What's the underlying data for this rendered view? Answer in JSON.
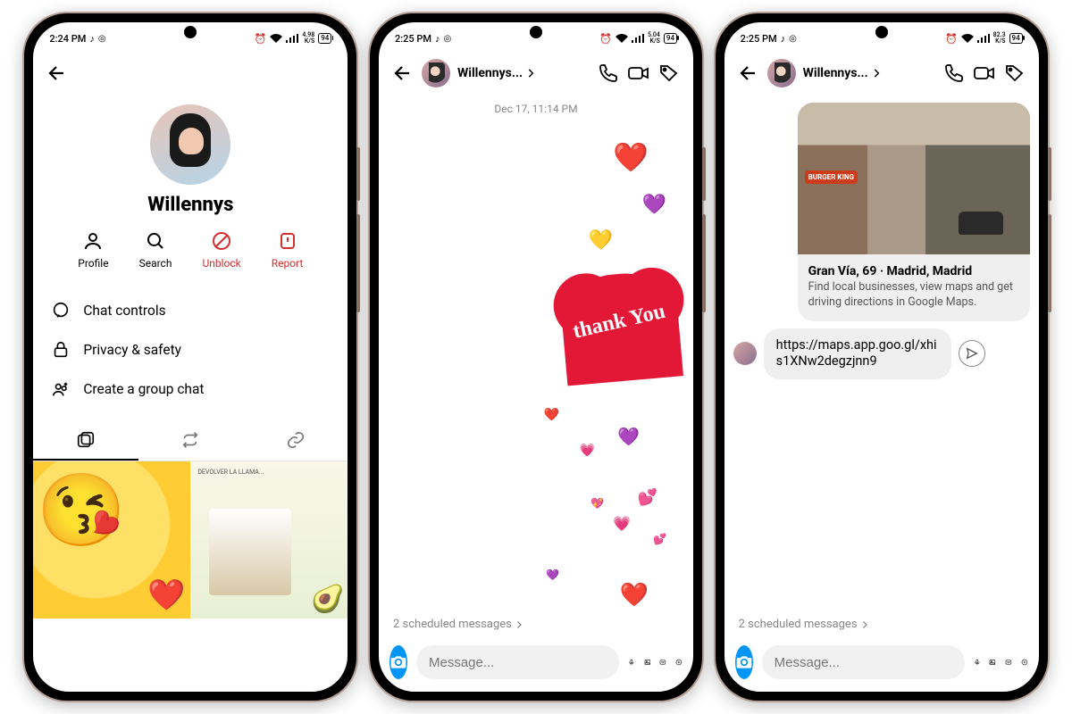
{
  "status": {
    "time1": "2:24 PM",
    "time2": "2:25 PM",
    "time3": "2:25 PM",
    "net1": "4.98",
    "net2": "5.04",
    "net3": "82.3",
    "kbs": "K/S",
    "batt": "94"
  },
  "phone1": {
    "name": "Willennys",
    "actions": [
      {
        "label": "Profile",
        "icon": "person-icon"
      },
      {
        "label": "Search",
        "icon": "search-icon"
      },
      {
        "label": "Unblock",
        "icon": "block-icon",
        "red": true
      },
      {
        "label": "Report",
        "icon": "report-icon",
        "red": true
      }
    ],
    "list": [
      {
        "label": "Chat controls",
        "icon": "chat-icon"
      },
      {
        "label": "Privacy & safety",
        "icon": "lock-icon"
      },
      {
        "label": "Create a group chat",
        "icon": "group-add-icon"
      }
    ],
    "thumb_caption": "DEVOLVER LA LLAMA..."
  },
  "phone2": {
    "title": "Willennys...",
    "date": "Dec 17, 11:14 PM",
    "sticker": "thank You",
    "scheduled": "2 scheduled messages",
    "placeholder": "Message..."
  },
  "phone3": {
    "title": "Willennys...",
    "card_title": "Gran Vía, 69 · Madrid, Madrid",
    "card_desc": "Find local businesses, view maps and get driving directions in Google Maps.",
    "url": "https://maps.app.goo.gl/xhis1XNw2degzjnn9",
    "scheduled": "2 scheduled messages",
    "placeholder": "Message..."
  }
}
